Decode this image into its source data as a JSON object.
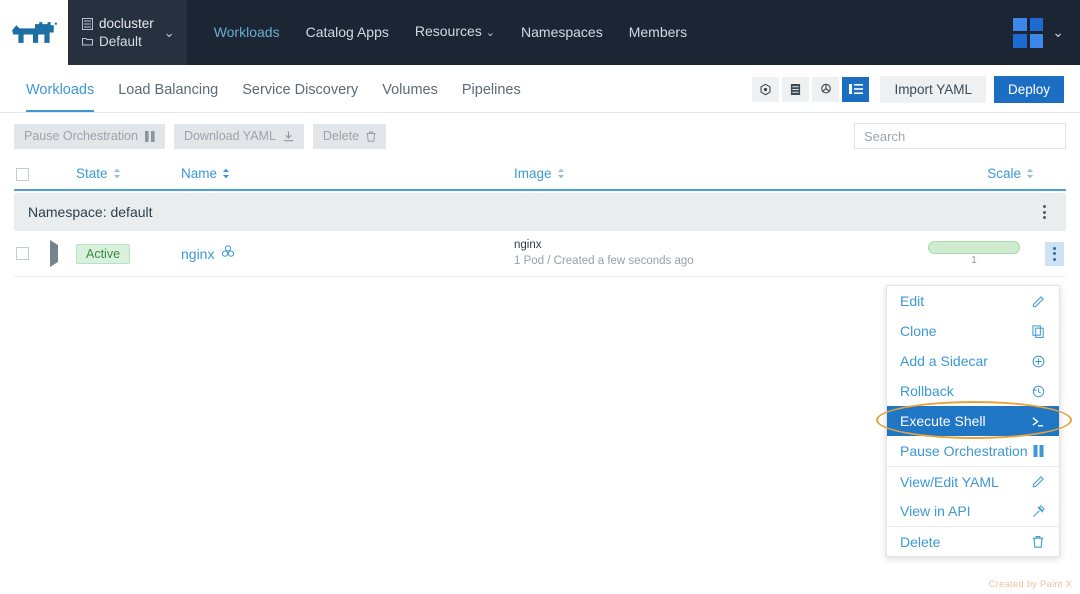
{
  "header": {
    "logo_icon": "rancher-cow-logo",
    "cluster": {
      "icon": "cluster-icon",
      "name": "docluster",
      "project_icon": "folder-icon",
      "project": "Default",
      "caret": "⌄"
    },
    "nav": [
      {
        "label": "Workloads",
        "active": true,
        "caret": ""
      },
      {
        "label": "Catalog Apps",
        "active": false,
        "caret": ""
      },
      {
        "label": "Resources",
        "active": false,
        "caret": "⌄"
      },
      {
        "label": "Namespaces",
        "active": false,
        "caret": ""
      },
      {
        "label": "Members",
        "active": false,
        "caret": ""
      }
    ],
    "user": {
      "avatar_icon": "grid-avatar-icon",
      "caret": "⌄"
    }
  },
  "tabs": [
    {
      "label": "Workloads",
      "active": true
    },
    {
      "label": "Load Balancing",
      "active": false
    },
    {
      "label": "Service Discovery",
      "active": false
    },
    {
      "label": "Volumes",
      "active": false
    },
    {
      "label": "Pipelines",
      "active": false
    }
  ],
  "tab_actions": {
    "view_icons": [
      {
        "name": "cluster-view-icon",
        "active": false
      },
      {
        "name": "node-view-icon",
        "active": false
      },
      {
        "name": "workload-view-icon",
        "active": false
      },
      {
        "name": "list-view-icon",
        "active": true
      }
    ],
    "import_yaml_label": "Import YAML",
    "deploy_label": "Deploy"
  },
  "action_bar": {
    "pause_label": "Pause Orchestration",
    "pause_icon": "pause-icon",
    "download_label": "Download YAML",
    "download_icon": "download-icon",
    "delete_label": "Delete",
    "delete_icon": "trash-icon",
    "search_placeholder": "Search",
    "search_value": ""
  },
  "table": {
    "columns": [
      {
        "label": "State",
        "sortable": true,
        "active_sort": false
      },
      {
        "label": "Name",
        "sortable": true,
        "active_sort": true
      },
      {
        "label": "Image",
        "sortable": true,
        "active_sort": false
      },
      {
        "label": "Scale",
        "sortable": true,
        "active_sort": false
      }
    ],
    "group": {
      "label": "Namespace: default"
    },
    "rows": [
      {
        "state": "Active",
        "name": "nginx",
        "name_icon": "kubernetes-icon",
        "image": "nginx",
        "image_sub": "1 Pod / Created a few seconds ago",
        "scale": "1"
      }
    ]
  },
  "context_menu": {
    "items": [
      {
        "label": "Edit",
        "icon": "pencil-icon",
        "selected": false,
        "divider_above": false
      },
      {
        "label": "Clone",
        "icon": "copy-icon",
        "selected": false,
        "divider_above": false
      },
      {
        "label": "Add a Sidecar",
        "icon": "plus-circle-icon",
        "selected": false,
        "divider_above": false
      },
      {
        "label": "Rollback",
        "icon": "history-icon",
        "selected": false,
        "divider_above": false
      },
      {
        "label": "Execute Shell",
        "icon": "terminal-icon",
        "selected": true,
        "divider_above": false
      },
      {
        "label": "Pause Orchestration",
        "icon": "pause-icon",
        "selected": false,
        "divider_above": false
      },
      {
        "label": "View/Edit YAML",
        "icon": "pencil-icon",
        "selected": false,
        "divider_above": true
      },
      {
        "label": "View in API",
        "icon": "api-icon",
        "selected": false,
        "divider_above": false
      },
      {
        "label": "Delete",
        "icon": "trash-icon",
        "selected": false,
        "divider_above": true
      }
    ]
  },
  "annotation": {
    "shape": "ellipse-highlight",
    "color": "#e8a33d",
    "target": "Execute Shell"
  },
  "watermark": {
    "text": "Created by Paint X"
  }
}
